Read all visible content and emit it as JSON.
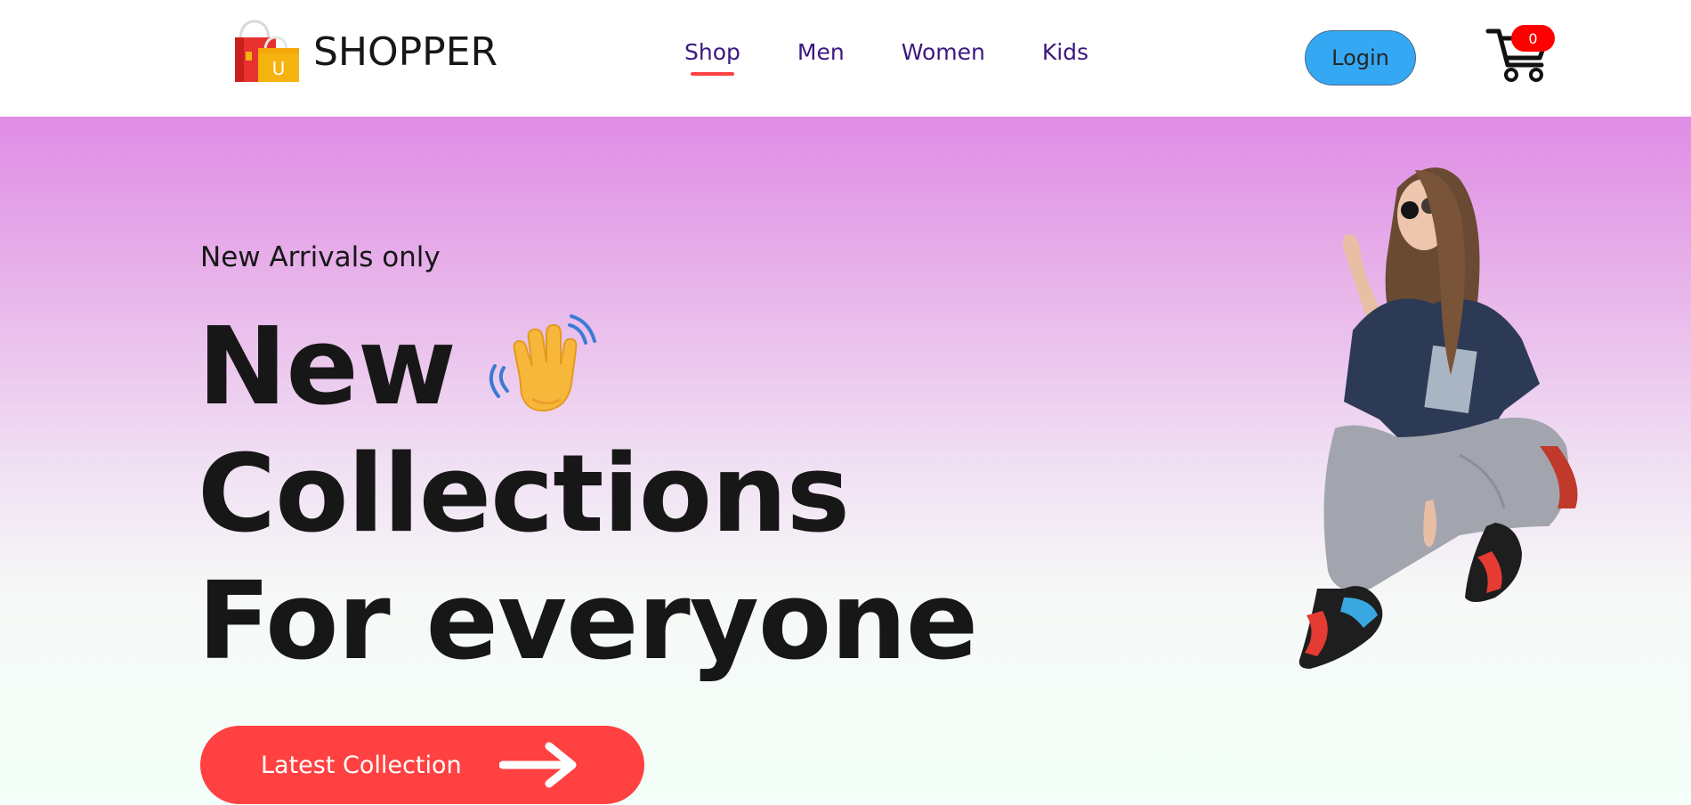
{
  "brand": {
    "name": "SHOPPER",
    "bag_letter": "U",
    "bag_colors": {
      "red": "#e8312f",
      "orange": "#f6b30f"
    }
  },
  "nav": {
    "items": [
      {
        "label": "Shop",
        "active": true
      },
      {
        "label": "Men",
        "active": false
      },
      {
        "label": "Women",
        "active": false
      },
      {
        "label": "Kids",
        "active": false
      }
    ],
    "text_color": "#3b1780",
    "active_underline_color": "#ff4141"
  },
  "login": {
    "label": "Login",
    "color": "#35a8f4"
  },
  "cart": {
    "icon": "shopping-cart-icon",
    "count": "0",
    "badge_color": "#ff0000"
  },
  "hero": {
    "subtitle": "New Arrivals only",
    "title_lines": [
      "New",
      "Collections",
      "For everyone"
    ],
    "wave_icon": "waving-hand-icon",
    "cta": {
      "label": "Latest Collection",
      "icon": "arrow-right-icon",
      "color": "#ff4141"
    },
    "image": "hero-model-image",
    "gradient": {
      "top": "#df8ce5",
      "bottom": "#f3fff9"
    }
  }
}
